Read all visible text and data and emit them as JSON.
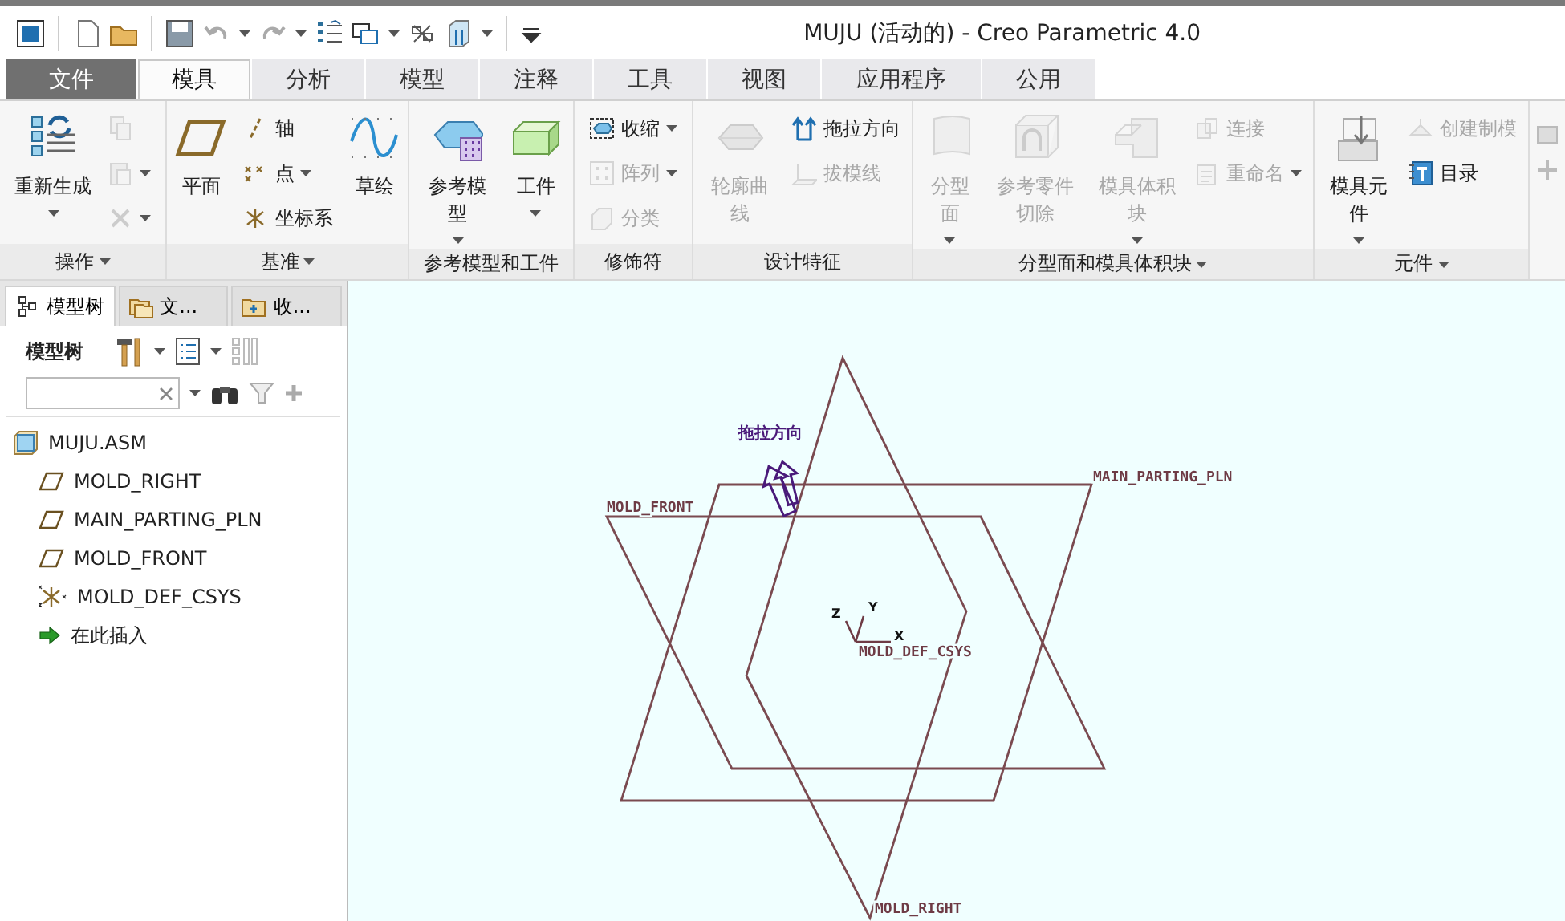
{
  "window": {
    "title": "MUJU (活动的) - Creo Parametric 4.0"
  },
  "tabs": [
    {
      "label": "文件",
      "kind": "file",
      "selected": false
    },
    {
      "label": "模具",
      "kind": "tab",
      "selected": true
    },
    {
      "label": "分析",
      "kind": "tab",
      "selected": false
    },
    {
      "label": "模型",
      "kind": "tab",
      "selected": false
    },
    {
      "label": "注释",
      "kind": "tab",
      "selected": false
    },
    {
      "label": "工具",
      "kind": "tab",
      "selected": false
    },
    {
      "label": "视图",
      "kind": "tab",
      "selected": false
    },
    {
      "label": "应用程序",
      "kind": "tab",
      "selected": false
    },
    {
      "label": "公用",
      "kind": "tab",
      "selected": false
    }
  ],
  "ribbon": {
    "groups": [
      {
        "label": "操作",
        "menu": true,
        "columns": [
          [
            {
              "kind": "large",
              "label": "重新生成",
              "dropdown": true,
              "disabled": false
            }
          ],
          [
            {
              "kind": "icon",
              "dropdown": false,
              "disabled": true
            },
            {
              "kind": "icon",
              "dropdown": true,
              "disabled": true
            },
            {
              "kind": "icon",
              "dropdown": true,
              "disabled": true
            }
          ]
        ]
      },
      {
        "label": "基准",
        "menu": true,
        "columns": [
          [
            {
              "kind": "large",
              "label": "平面",
              "dropdown": false,
              "disabled": false
            }
          ],
          [
            {
              "kind": "small",
              "label": "轴",
              "dropdown": false,
              "disabled": false
            },
            {
              "kind": "small",
              "label": "点",
              "dropdown": true,
              "disabled": false
            },
            {
              "kind": "small",
              "label": "坐标系",
              "dropdown": false,
              "disabled": false
            }
          ],
          [
            {
              "kind": "large",
              "label": "草绘",
              "dropdown": false,
              "disabled": false
            }
          ]
        ]
      },
      {
        "label": "参考模型和工件",
        "menu": false,
        "columns": [
          [
            {
              "kind": "large",
              "label": "参考模型",
              "dropdown": true,
              "disabled": false
            }
          ],
          [
            {
              "kind": "large",
              "label": "工件",
              "dropdown": true,
              "disabled": false
            }
          ]
        ]
      },
      {
        "label": "修饰符",
        "menu": false,
        "columns": [
          [
            {
              "kind": "small",
              "label": "收缩",
              "dropdown": true,
              "disabled": false
            },
            {
              "kind": "small",
              "label": "阵列",
              "dropdown": true,
              "disabled": true
            },
            {
              "kind": "small",
              "label": "分类",
              "dropdown": false,
              "disabled": true
            }
          ]
        ]
      },
      {
        "label": "设计特征",
        "menu": false,
        "columns": [
          [
            {
              "kind": "large",
              "label": "轮廓曲线",
              "dropdown": false,
              "disabled": true
            }
          ],
          [
            {
              "kind": "small",
              "label": "拖拉方向",
              "dropdown": false,
              "disabled": false
            },
            {
              "kind": "small",
              "label": "拔模线",
              "dropdown": false,
              "disabled": true
            }
          ]
        ]
      },
      {
        "label": "分型面和模具体积块",
        "menu": true,
        "columns": [
          [
            {
              "kind": "large",
              "label": "分型面",
              "dropdown": true,
              "disabled": true
            }
          ],
          [
            {
              "kind": "large",
              "label": "参考零件切除",
              "dropdown": false,
              "disabled": true
            }
          ],
          [
            {
              "kind": "large",
              "label": "模具体积块",
              "dropdown": true,
              "disabled": true
            }
          ],
          [
            {
              "kind": "small",
              "label": "连接",
              "dropdown": false,
              "disabled": true
            },
            {
              "kind": "small",
              "label": "重命名",
              "dropdown": true,
              "disabled": true
            }
          ]
        ]
      },
      {
        "label": "元件",
        "menu": true,
        "columns": [
          [
            {
              "kind": "large",
              "label": "模具元件",
              "dropdown": true,
              "disabled": false
            }
          ],
          [
            {
              "kind": "small",
              "label": "创建制模",
              "dropdown": false,
              "disabled": true
            },
            {
              "kind": "small",
              "label": "目录",
              "dropdown": false,
              "disabled": false
            }
          ]
        ]
      }
    ]
  },
  "model_tree": {
    "tabs": [
      {
        "label": "模型树",
        "selected": true
      },
      {
        "label": "文...",
        "selected": false
      },
      {
        "label": "收...",
        "selected": false
      }
    ],
    "title": "模型树",
    "items": [
      {
        "label": "MUJU.ASM",
        "kind": "assembly",
        "children": [
          {
            "label": "MOLD_RIGHT",
            "kind": "plane"
          },
          {
            "label": "MAIN_PARTING_PLN",
            "kind": "plane"
          },
          {
            "label": "MOLD_FRONT",
            "kind": "plane"
          },
          {
            "label": "MOLD_DEF_CSYS",
            "kind": "csys"
          },
          {
            "label": "在此插入",
            "kind": "insert"
          }
        ]
      }
    ]
  },
  "canvas": {
    "planes": [
      {
        "label": "MAIN_PARTING_PLN"
      },
      {
        "label": "MOLD_FRONT"
      },
      {
        "label": "MOLD_RIGHT"
      }
    ],
    "pull_direction": {
      "label": "拖拉方向"
    },
    "csys": {
      "label": "MOLD_DEF_CSYS",
      "axes": [
        "X",
        "Y",
        "Z"
      ]
    }
  }
}
